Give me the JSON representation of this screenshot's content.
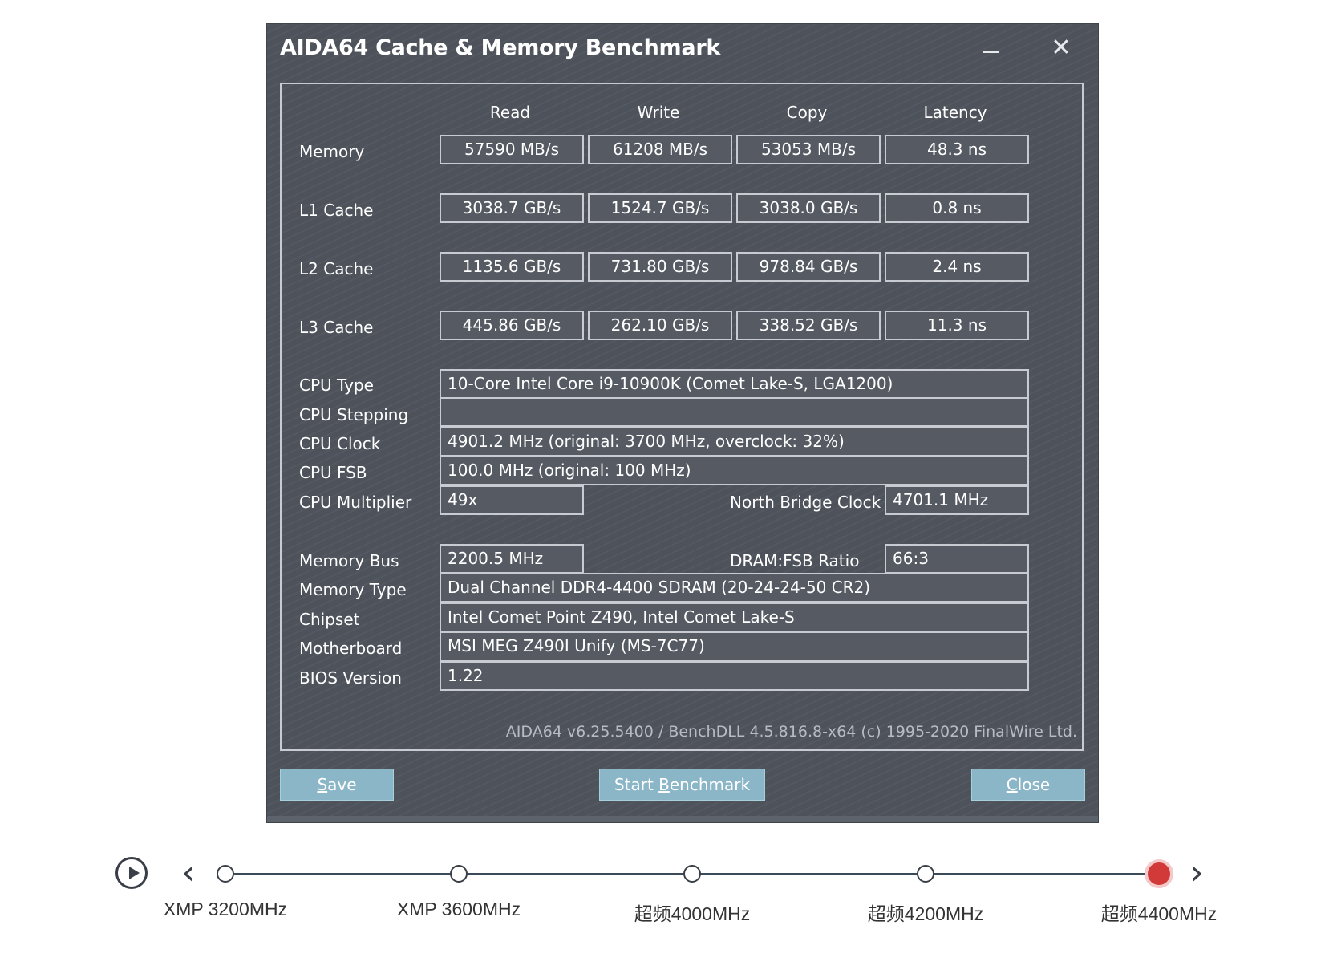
{
  "window": {
    "title": "AIDA64 Cache & Memory Benchmark",
    "minimize_glyph": "–",
    "close_glyph": "✕"
  },
  "columns": [
    "Read",
    "Write",
    "Copy",
    "Latency"
  ],
  "bench_rows": [
    {
      "label": "Memory",
      "values": [
        "57590 MB/s",
        "61208 MB/s",
        "53053 MB/s",
        "48.3 ns"
      ]
    },
    {
      "label": "L1 Cache",
      "values": [
        "3038.7 GB/s",
        "1524.7 GB/s",
        "3038.0 GB/s",
        "0.8 ns"
      ]
    },
    {
      "label": "L2 Cache",
      "values": [
        "1135.6 GB/s",
        "731.80 GB/s",
        "978.84 GB/s",
        "2.4 ns"
      ]
    },
    {
      "label": "L3 Cache",
      "values": [
        "445.86 GB/s",
        "262.10 GB/s",
        "338.52 GB/s",
        "11.3 ns"
      ]
    }
  ],
  "info": {
    "cpu_type": {
      "label": "CPU Type",
      "value": "10-Core Intel Core i9-10900K  (Comet Lake-S, LGA1200)"
    },
    "cpu_stepping": {
      "label": "CPU Stepping",
      "value": ""
    },
    "cpu_clock": {
      "label": "CPU Clock",
      "value": "4901.2 MHz  (original: 3700 MHz, overclock: 32%)"
    },
    "cpu_fsb": {
      "label": "CPU FSB",
      "value": "100.0 MHz  (original: 100 MHz)"
    },
    "cpu_multiplier": {
      "label": "CPU Multiplier",
      "value": "49x"
    },
    "north_bridge_clock": {
      "label": "North Bridge Clock",
      "value": "4701.1 MHz"
    },
    "memory_bus": {
      "label": "Memory Bus",
      "value": "2200.5 MHz"
    },
    "dram_fsb_ratio": {
      "label": "DRAM:FSB Ratio",
      "value": "66:3"
    },
    "memory_type": {
      "label": "Memory Type",
      "value": "Dual Channel DDR4-4400 SDRAM  (20-24-24-50 CR2)"
    },
    "chipset": {
      "label": "Chipset",
      "value": "Intel Comet Point Z490, Intel Comet Lake-S"
    },
    "motherboard": {
      "label": "Motherboard",
      "value": "MSI MEG Z490I Unify (MS-7C77)"
    },
    "bios_version": {
      "label": "BIOS Version",
      "value": "1.22"
    }
  },
  "footer_version": "AIDA64 v6.25.5400 / BenchDLL 4.5.816.8-x64  (c) 1995-2020 FinalWire Ltd.",
  "buttons": {
    "save": {
      "accel": "S",
      "rest": "ave"
    },
    "start": {
      "prefix": "Start ",
      "accel": "B",
      "rest": "enchmark"
    },
    "close": {
      "accel": "C",
      "rest": "lose"
    }
  },
  "timeline": {
    "prev_glyph": "‹",
    "next_glyph": "›",
    "steps": [
      "XMP 3200MHz",
      "XMP 3600MHz",
      "超频4000MHz",
      "超频4200MHz",
      "超频4400MHz"
    ],
    "active_index": 4
  }
}
